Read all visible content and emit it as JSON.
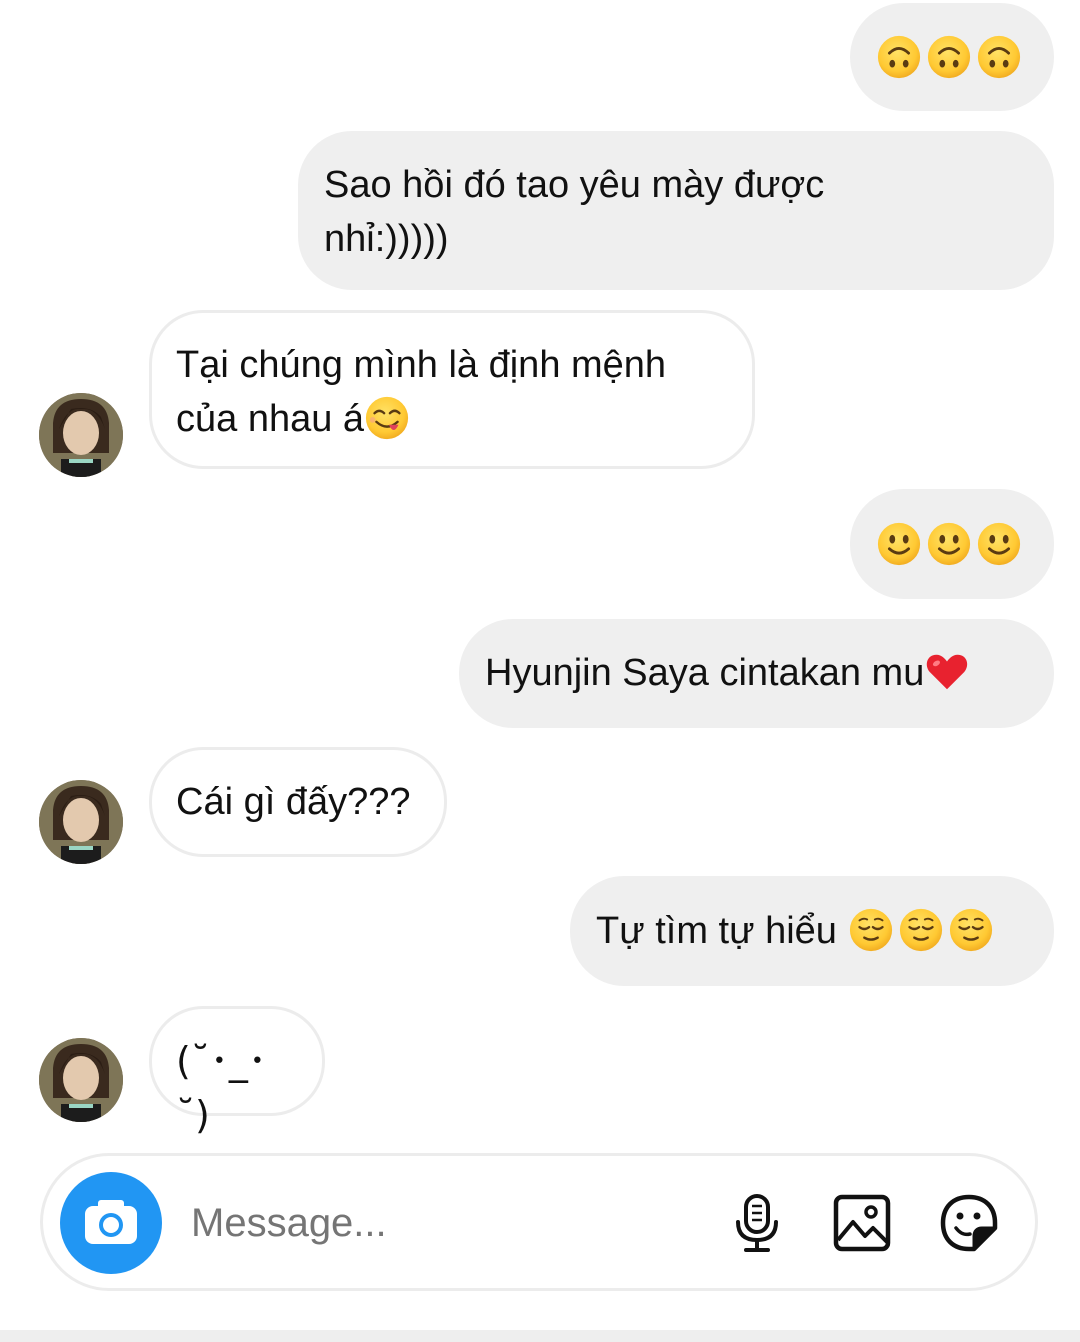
{
  "messages": [
    {
      "direction": "out",
      "kind": "emoji",
      "emoji": [
        "upside-down-face",
        "upside-down-face",
        "upside-down-face"
      ]
    },
    {
      "direction": "out",
      "kind": "text",
      "lines": [
        "Sao hồi đó tao yêu mày được",
        "nhỉ:)))))"
      ]
    },
    {
      "direction": "in",
      "kind": "text",
      "lines": [
        "Tại chúng mình là định mệnh",
        "của nhau á"
      ],
      "trailing_emoji": "face-savoring-food"
    },
    {
      "direction": "out",
      "kind": "emoji",
      "emoji": [
        "slightly-smiling-face",
        "slightly-smiling-face",
        "slightly-smiling-face"
      ]
    },
    {
      "direction": "out",
      "kind": "text",
      "lines": [
        "Hyunjin Saya cintakan mu"
      ],
      "trailing_emoji": "red-heart"
    },
    {
      "direction": "in",
      "kind": "text",
      "lines": [
        "Cái gì đấy???"
      ]
    },
    {
      "direction": "out",
      "kind": "text",
      "lines": [
        "Tự tìm tự hiểu "
      ],
      "trailing_emoji_group": [
        "relieved-face",
        "relieved-face",
        "relieved-face"
      ]
    },
    {
      "direction": "in",
      "kind": "text",
      "lines": [
        "(˘･_･˘)"
      ]
    }
  ],
  "composer": {
    "placeholder": "Message...",
    "camera_icon": "camera-icon",
    "mic_icon": "microphone-icon",
    "gallery_icon": "image-gallery-icon",
    "sticker_icon": "sticker-icon"
  },
  "colors": {
    "outgoing_bubble": "#efefef",
    "incoming_border": "#ececec",
    "camera_button": "#2196f3",
    "emoji_yellow": "#ffcc3d",
    "heart_red": "#e8222f"
  }
}
